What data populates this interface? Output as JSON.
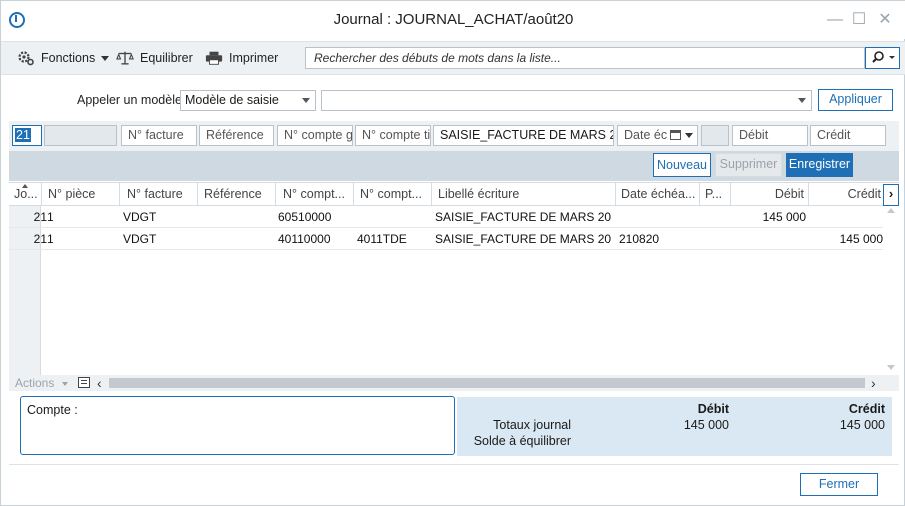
{
  "window": {
    "title": "Journal : JOURNAL_ACHAT/août20"
  },
  "toolbar": {
    "fonctions": "Fonctions",
    "equilibrer": "Equilibrer",
    "imprimer": "Imprimer",
    "search_placeholder": "Rechercher des débuts de mots dans la liste..."
  },
  "modele": {
    "label": "Appeler un modèle",
    "selected": "Modèle de saisie",
    "value": "",
    "apply": "Appliquer"
  },
  "entry": {
    "journal": "21",
    "piece": "",
    "facture": "N° facture",
    "reference": "Référence",
    "compte_general": "N° compte g",
    "compte_tiers": "N° compte ti",
    "libelle": "SAISIE_FACTURE DE MARS 20",
    "date": "Date éc",
    "p": "",
    "debit": "Débit",
    "credit": "Crédit"
  },
  "actions": {
    "nouveau": "Nouveau",
    "supprimer": "Supprimer",
    "enregistrer": "Enregistrer"
  },
  "grid": {
    "columns": [
      "Jo...",
      "N° pièce",
      "N° facture",
      "Référence",
      "N° compt...",
      "N° compt...",
      "Libellé écriture",
      "Date échéa...",
      "P...",
      "Débit",
      "Crédit"
    ],
    "rows": [
      [
        "21",
        "1",
        "VDGT",
        "",
        "60510000",
        "",
        "SAISIE_FACTURE DE MARS 20",
        "",
        "",
        "145 000",
        ""
      ],
      [
        "21",
        "1",
        "VDGT",
        "",
        "40110000",
        "4011TDE",
        "SAISIE_FACTURE DE MARS 20",
        "210820",
        "",
        "",
        "145 000"
      ]
    ],
    "actions_label": "Actions"
  },
  "footer": {
    "compte_label": "Compte :",
    "debit_header": "Débit",
    "credit_header": "Crédit",
    "totaux_label": "Totaux journal",
    "totaux_debit": "145 000",
    "totaux_credit": "145 000",
    "solde_label": "Solde à équilibrer",
    "fermer": "Fermer"
  },
  "colors": {
    "accent": "#1e6fb5",
    "panel": "#eef1f3",
    "totals": "#d9e8f3"
  }
}
